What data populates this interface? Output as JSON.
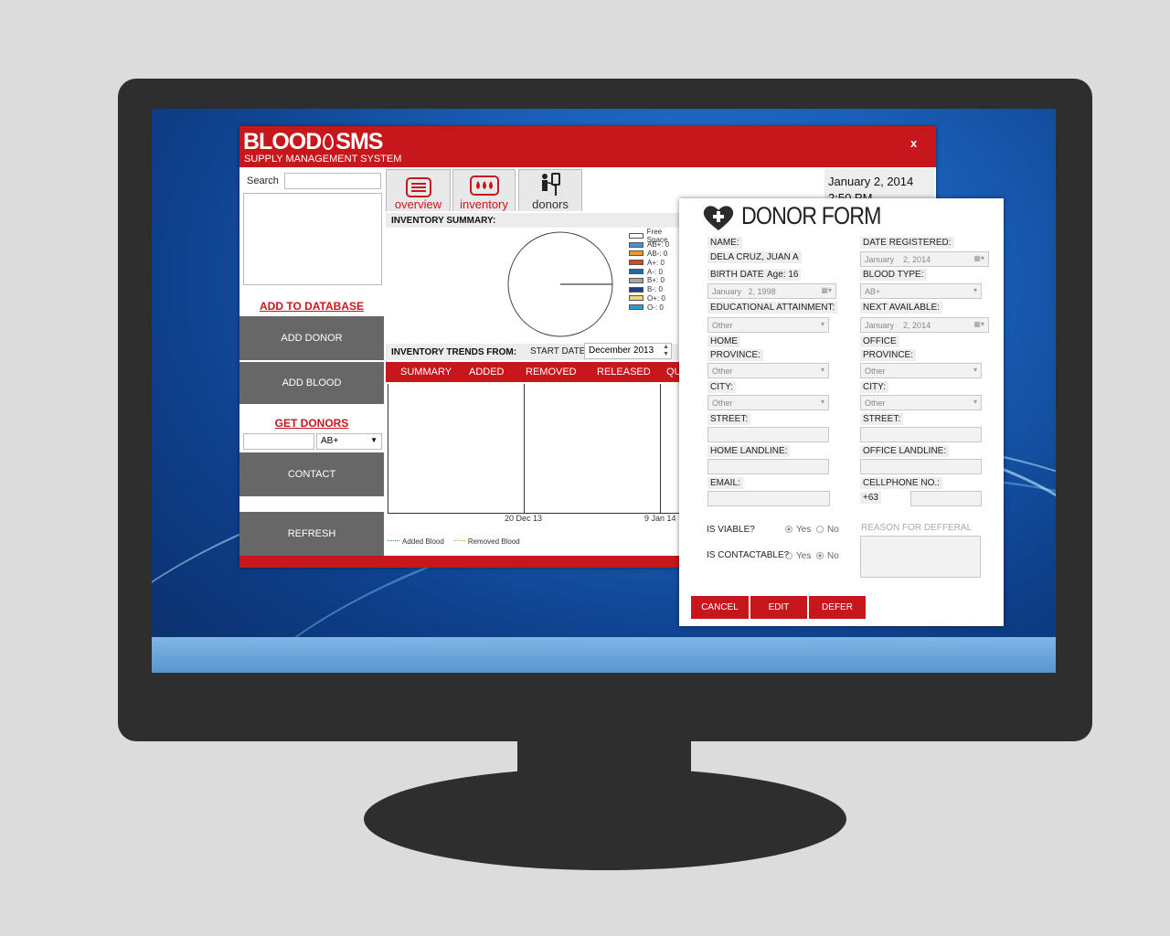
{
  "app": {
    "logo_text_1": "BLOOD",
    "logo_text_2": "SMS",
    "tagline": "SUPPLY MANAGEMENT SYSTEM",
    "close_label": "x",
    "date": "January 2, 2014",
    "time": "2:50 PM"
  },
  "sidebar": {
    "search_label": "Search",
    "search_value": "",
    "add_to_database": "ADD TO DATABASE",
    "add_donor": "ADD DONOR",
    "add_blood": "ADD BLOOD",
    "get_donors": "GET DONORS",
    "blood_select": "AB+",
    "contact": "CONTACT",
    "refresh": "REFRESH"
  },
  "tabs": [
    {
      "label": "overview"
    },
    {
      "label": "inventory"
    },
    {
      "label": "donors"
    }
  ],
  "summary": {
    "title": "INVENTORY SUMMARY:",
    "legend": [
      {
        "label": "Free Space",
        "color": "#ffffff"
      },
      {
        "label": "AB+: 0",
        "color": "#4a90d9"
      },
      {
        "label": "AB-: 0",
        "color": "#e89a2b"
      },
      {
        "label": "A+: 0",
        "color": "#d04a1f"
      },
      {
        "label": "A-: 0",
        "color": "#1e6aa8"
      },
      {
        "label": "B+: 0",
        "color": "#a8a8a8"
      },
      {
        "label": "B-: 0",
        "color": "#1f3f7a"
      },
      {
        "label": "O+: 0",
        "color": "#f2d776"
      },
      {
        "label": "O-: 0",
        "color": "#2a9ad8"
      }
    ]
  },
  "trends": {
    "title": "INVENTORY TRENDS FROM:",
    "start_label": "START DATE",
    "start_value": "December 2013",
    "columns": [
      "SUMMARY",
      "ADDED",
      "REMOVED",
      "RELEASED",
      "QU"
    ],
    "x_ticks": [
      "20 Dec 13",
      "9 Jan 14"
    ],
    "legend": [
      {
        "label": "Added Blood",
        "color": "#3a6fd0"
      },
      {
        "label": "Removed Blood",
        "color": "#e89a2b"
      }
    ]
  },
  "donor_form": {
    "title": "DONOR FORM",
    "name_label": "NAME:",
    "name_value": "DELA CRUZ, JUAN A",
    "birth_label": "BIRTH DATE:",
    "age_label": "Age: 16",
    "birth_month": "January",
    "birth_day": "2, 1998",
    "edu_label": "EDUCATIONAL ATTAINMENT:",
    "edu_value": "Other",
    "home_label": "HOME",
    "province_label": "PROVINCE:",
    "home_province": "Other",
    "city_label": "CITY:",
    "home_city": "Other",
    "street_label": "STREET:",
    "home_landline_label": "HOME LANDLINE:",
    "email_label": "EMAIL:",
    "date_reg_label": "DATE REGISTERED:",
    "reg_month": "January",
    "reg_day": "2, 2014",
    "blood_type_label": "BLOOD TYPE:",
    "blood_type_value": "AB+",
    "next_label": "NEXT AVAILABLE:",
    "next_month": "January",
    "next_day": "2, 2014",
    "office_label": "OFFICE",
    "office_province": "Other",
    "office_city": "Other",
    "office_landline_label": "OFFICE LANDLINE:",
    "cell_label": "CELLPHONE NO.:",
    "cell_prefix": "+63",
    "viable_label": "IS VIABLE?",
    "contactable_label": "IS CONTACTABLE?",
    "yes": "Yes",
    "no": "No",
    "reason_label": "REASON FOR DEFFERAL",
    "cancel": "CANCEL",
    "edit": "EDIT",
    "defer": "DEFER"
  }
}
